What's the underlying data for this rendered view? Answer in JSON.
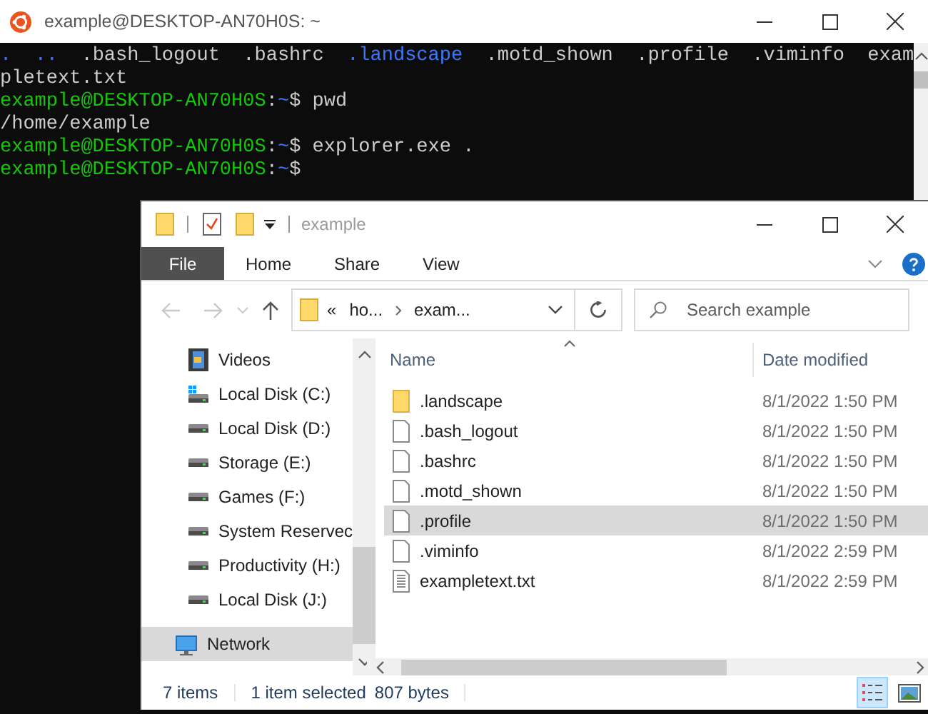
{
  "terminal": {
    "title": "example@DESKTOP-AN70H0S: ~",
    "lines": [
      {
        "kind": "listing",
        "segments": [
          {
            "text": ".",
            "kind": "dir"
          },
          {
            "text": "..",
            "kind": "dir"
          },
          {
            "text": ".bash_logout",
            "kind": "file"
          },
          {
            "text": ".bashrc",
            "kind": "file"
          },
          {
            "text": ".landscape",
            "kind": "dir"
          },
          {
            "text": ".motd_shown",
            "kind": "file"
          },
          {
            "text": ".profile",
            "kind": "file"
          },
          {
            "text": ".viminfo",
            "kind": "file"
          },
          {
            "text": "exam",
            "kind": "file"
          }
        ]
      },
      {
        "kind": "listing",
        "segments": [
          {
            "text": "pletext.txt",
            "kind": "file"
          }
        ]
      },
      {
        "kind": "joined",
        "segments": [
          {
            "text": "example@DESKTOP-AN70H0S",
            "kind": "user"
          },
          {
            "text": ":",
            "kind": "file"
          },
          {
            "text": "~",
            "kind": "dir"
          },
          {
            "text": "$ pwd",
            "kind": "file"
          }
        ]
      },
      {
        "kind": "joined",
        "segments": [
          {
            "text": "/home/example",
            "kind": "file"
          }
        ]
      },
      {
        "kind": "joined",
        "segments": [
          {
            "text": "example@DESKTOP-AN70H0S",
            "kind": "user"
          },
          {
            "text": ":",
            "kind": "file"
          },
          {
            "text": "~",
            "kind": "dir"
          },
          {
            "text": "$ explorer.exe .",
            "kind": "file"
          }
        ]
      },
      {
        "kind": "joined",
        "segments": [
          {
            "text": "example@DESKTOP-AN70H0S",
            "kind": "user"
          },
          {
            "text": ":",
            "kind": "file"
          },
          {
            "text": "~",
            "kind": "dir"
          },
          {
            "text": "$",
            "kind": "file"
          }
        ]
      }
    ]
  },
  "explorer": {
    "title": "example",
    "ribbon_tabs": [
      {
        "label": "File",
        "kind": "file_menu"
      },
      {
        "label": "Home",
        "kind": "tab"
      },
      {
        "label": "Share",
        "kind": "tab"
      },
      {
        "label": "View",
        "kind": "tab"
      }
    ],
    "address": {
      "overflow": "«",
      "segments": [
        "ho...",
        "exam..."
      ]
    },
    "search": {
      "placeholder": "Search example"
    },
    "nav_pane": {
      "items": [
        {
          "label": "Videos",
          "kind": "videos",
          "selected": false
        },
        {
          "label": "Local Disk (C:)",
          "kind": "system_drive",
          "selected": false
        },
        {
          "label": "Local Disk (D:)",
          "kind": "drive",
          "selected": false
        },
        {
          "label": "Storage (E:)",
          "kind": "drive",
          "selected": false
        },
        {
          "label": "Games (F:)",
          "kind": "drive",
          "selected": false
        },
        {
          "label": "System Reservec",
          "kind": "drive",
          "selected": false
        },
        {
          "label": "Productivity (H:)",
          "kind": "drive",
          "selected": false
        },
        {
          "label": "Local Disk (J:)",
          "kind": "drive",
          "selected": false
        }
      ],
      "network": {
        "label": "Network",
        "selected": true
      }
    },
    "columns": [
      "Name",
      "Date modified"
    ],
    "rows": [
      {
        "name": ".landscape",
        "date": "8/1/2022 1:50 PM",
        "kind": "folder",
        "selected": false
      },
      {
        "name": ".bash_logout",
        "date": "8/1/2022 1:50 PM",
        "kind": "file",
        "selected": false
      },
      {
        "name": ".bashrc",
        "date": "8/1/2022 1:50 PM",
        "kind": "file",
        "selected": false
      },
      {
        "name": ".motd_shown",
        "date": "8/1/2022 1:50 PM",
        "kind": "file",
        "selected": false
      },
      {
        "name": ".profile",
        "date": "8/1/2022 1:50 PM",
        "kind": "file",
        "selected": true
      },
      {
        "name": ".viminfo",
        "date": "8/1/2022 2:59 PM",
        "kind": "file",
        "selected": false
      },
      {
        "name": "exampletext.txt",
        "date": "8/1/2022 2:59 PM",
        "kind": "text",
        "selected": false
      }
    ],
    "status": {
      "item_count": "7 items",
      "selection": "1 item selected",
      "size": "807 bytes"
    },
    "views": [
      {
        "kind": "details",
        "selected": true
      },
      {
        "kind": "large_icons",
        "selected": false
      }
    ]
  }
}
